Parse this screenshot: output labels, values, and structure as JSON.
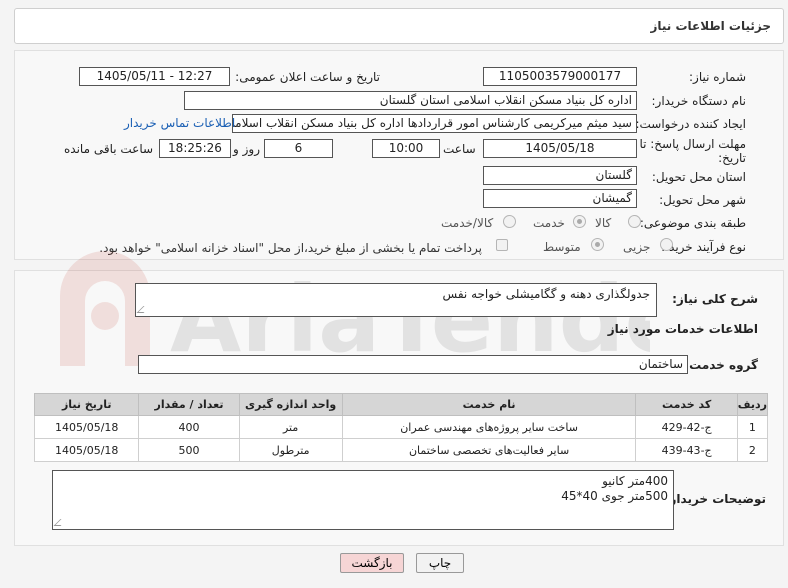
{
  "header": {
    "title": "جزئیات اطلاعات نیاز"
  },
  "form": {
    "need_number_label": "شماره نیاز:",
    "need_number": "1105003579000177",
    "announce_label": "تاریخ و ساعت اعلان عمومی:",
    "announce_value": "1405/05/11 - 12:27",
    "buyer_org_label": "نام دستگاه خریدار:",
    "buyer_org": "اداره کل بنیاد مسکن انقلاب اسلامی استان گلستان",
    "requester_label": "ایجاد کننده درخواست:",
    "requester": "سید میثم میرکریمی کارشناس امور قراردادها اداره کل بنیاد مسکن انقلاب اسلامی",
    "contact_link": "اطلاعات تماس خریدار",
    "deadline_label_1": "مهلت ارسال پاسخ: تا",
    "deadline_label_2": "تاریخ:",
    "deadline_date": "1405/05/18",
    "time_label": "ساعت",
    "deadline_time": "10:00",
    "days_value": "6",
    "days_label": "روز و",
    "remaining_time": "18:25:26",
    "remaining_label": "ساعت باقی مانده",
    "province_label": "استان محل تحویل:",
    "province": "گلستان",
    "city_label": "شهر محل تحویل:",
    "city": "گمیشان",
    "category_label": "طبقه بندی موضوعی:",
    "category_options": [
      "کالا",
      "خدمت",
      "کالا/خدمت"
    ],
    "category_selected": "خدمت",
    "process_label": "نوع فرآیند خرید :",
    "process_options": [
      "جزیی",
      "متوسط"
    ],
    "process_selected": "متوسط",
    "payment_note": "پرداخت تمام یا بخشی از مبلغ خرید،از محل \"اسناد خزانه اسلامی\" خواهد بود."
  },
  "summary": {
    "label": "شرح کلی نیاز:",
    "value": "جدولگذاری دهنه و گگامیشلی خواجه نفس"
  },
  "services": {
    "section_title": "اطلاعات خدمات مورد نیاز",
    "group_label": "گروه خدمت:",
    "group_value": "ساختمان",
    "columns": [
      "ردیف",
      "کد خدمت",
      "نام خدمت",
      "واحد اندازه گیری",
      "تعداد / مقدار",
      "تاریخ نیاز"
    ],
    "rows": [
      {
        "idx": "1",
        "code": "ج-42-429",
        "name": "ساخت سایر پروژه‌های مهندسی عمران",
        "unit": "متر",
        "qty": "400",
        "date": "1405/05/18"
      },
      {
        "idx": "2",
        "code": "ج-43-439",
        "name": "سایر فعالیت‌های تخصصی ساختمان",
        "unit": "مترطول",
        "qty": "500",
        "date": "1405/05/18"
      }
    ]
  },
  "buyer_notes": {
    "label": "توضیحات خریدار:",
    "line1": "400متر کانیو",
    "line2": "500متر جوی 40*45"
  },
  "buttons": {
    "print": "چاپ",
    "back": "بازگشت"
  },
  "watermark": "AriaTender.net",
  "colors": {
    "link": "#1a5fb4",
    "back_button": "#f6d5d5",
    "print_button": "#f2f2f2",
    "table_header": "#d6d6d6"
  }
}
